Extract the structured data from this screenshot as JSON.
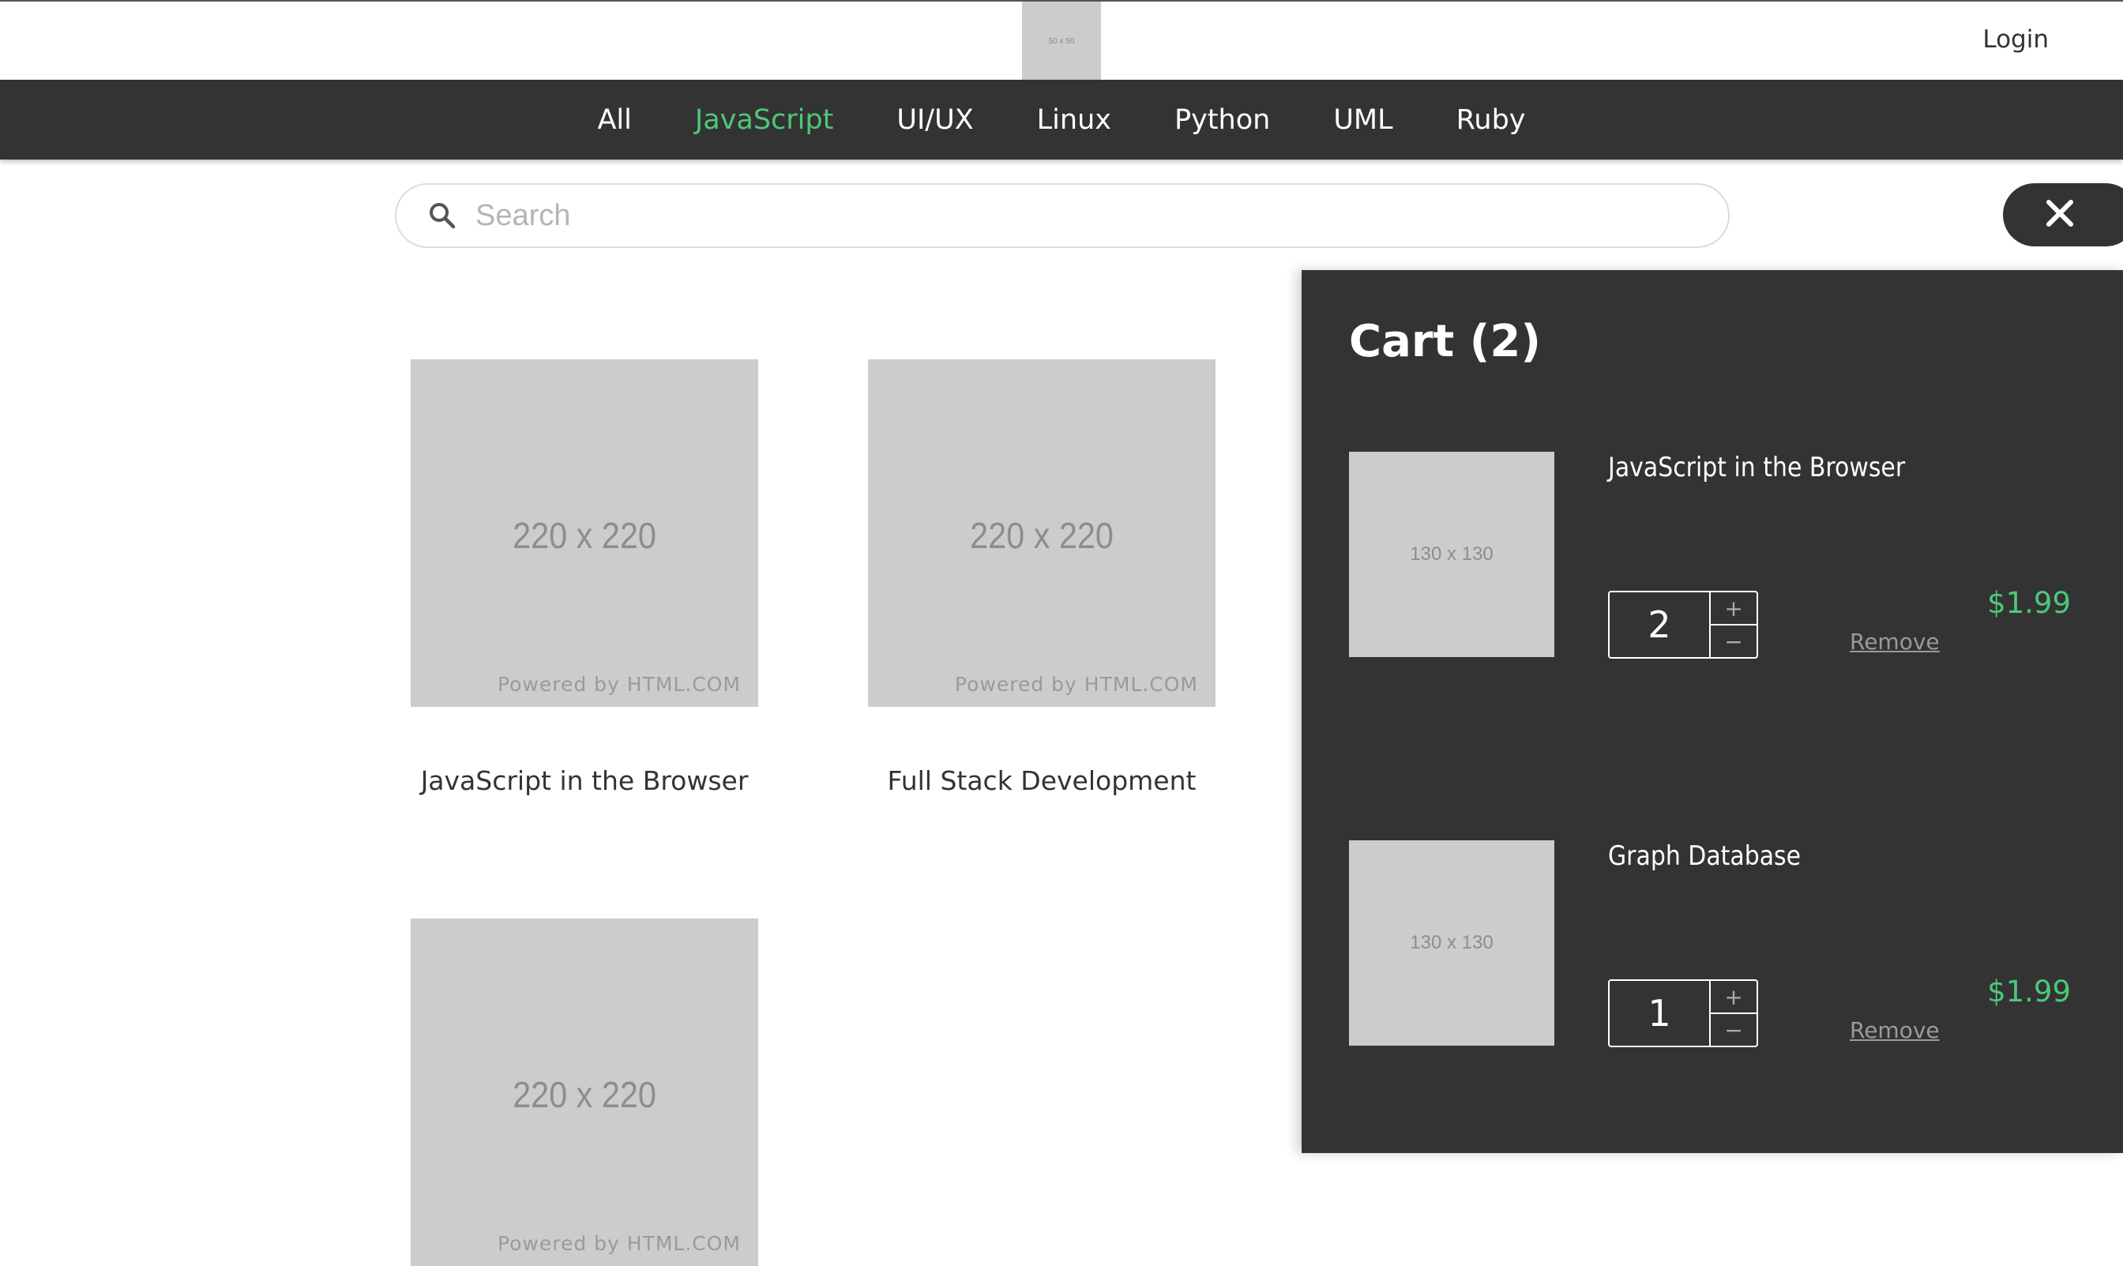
{
  "header": {
    "logo_text": "50 x 50",
    "login_label": "Login"
  },
  "nav": {
    "categories": [
      {
        "label": "All",
        "active": false
      },
      {
        "label": "JavaScript",
        "active": true
      },
      {
        "label": "UI/UX",
        "active": false
      },
      {
        "label": "Linux",
        "active": false
      },
      {
        "label": "Python",
        "active": false
      },
      {
        "label": "UML",
        "active": false
      },
      {
        "label": "Ruby",
        "active": false
      }
    ]
  },
  "search": {
    "placeholder": "Search",
    "value": "",
    "icon": "search-icon"
  },
  "close_icon": "close-icon",
  "products": [
    {
      "thumb_text": "220 x 220",
      "powered_text": "Powered by HTML.COM",
      "title": "JavaScript in the Browser"
    },
    {
      "thumb_text": "220 x 220",
      "powered_text": "Powered by HTML.COM",
      "title": "Full Stack Development"
    },
    {
      "thumb_text": "220 x 220",
      "powered_text": "Powered by HTML.COM",
      "title": ""
    }
  ],
  "cart": {
    "title": "Cart (2)",
    "items": [
      {
        "thumb_text": "130 x 130",
        "name": "JavaScript in the Browser",
        "quantity": "2",
        "plus_label": "+",
        "minus_label": "−",
        "remove_label": "Remove",
        "price": "$1.99"
      },
      {
        "thumb_text": "130 x 130",
        "name": "Graph Database",
        "quantity": "1",
        "plus_label": "+",
        "minus_label": "−",
        "remove_label": "Remove",
        "price": "$1.99"
      }
    ]
  },
  "colors": {
    "dark": "#333333",
    "accent_green": "#4cc87a",
    "placeholder_gray": "#cccccc"
  }
}
